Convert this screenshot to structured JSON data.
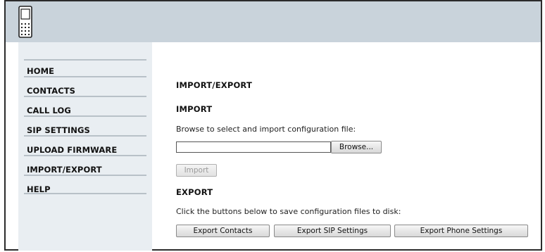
{
  "sidebar": {
    "items": [
      {
        "label": "HOME"
      },
      {
        "label": "CONTACTS"
      },
      {
        "label": "CALL LOG"
      },
      {
        "label": "SIP SETTINGS"
      },
      {
        "label": "UPLOAD FIRMWARE"
      },
      {
        "label": "IMPORT/EXPORT"
      },
      {
        "label": "HELP"
      }
    ]
  },
  "main": {
    "page_title": "IMPORT/EXPORT",
    "import": {
      "heading": "IMPORT",
      "instruction": "Browse to select and import configuration file:",
      "file_value": "",
      "browse_label": "Browse...",
      "import_label": "Import"
    },
    "export": {
      "heading": "EXPORT",
      "instruction": "Click the buttons below to save configuration files to disk:",
      "contacts_label": "Export Contacts",
      "sip_label": "Export SIP Settings",
      "phone_label": "Export Phone Settings"
    }
  },
  "colors": {
    "header_bg": "#c9d3db",
    "sidebar_bg": "#e9eef2",
    "frame_border": "#2b2b2b"
  },
  "icons": {
    "logo": "phone-icon"
  }
}
